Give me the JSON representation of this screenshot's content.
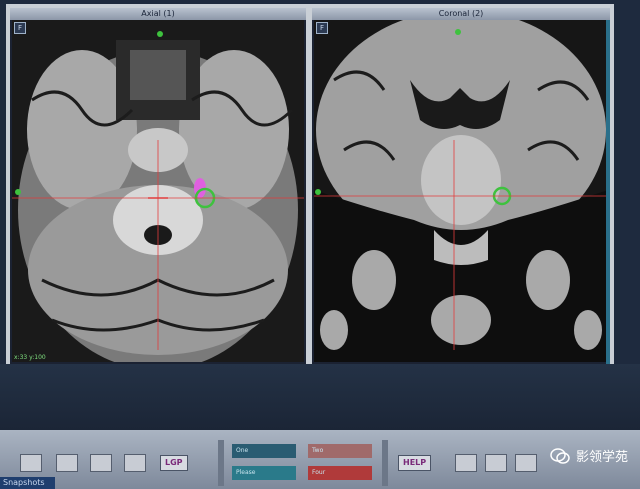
{
  "viewer": {
    "axial": {
      "title": "Axial (1)",
      "corner": "F",
      "coord": "x:33  y:100"
    },
    "coronal": {
      "title": "Coronal (2)",
      "corner": "F"
    }
  },
  "toolbar": {
    "brand_left": "LGP",
    "brand_right": "HELP",
    "fields": [
      "One",
      "Two",
      "Please",
      "Four"
    ],
    "snapshot": "Snapshots"
  },
  "watermark": {
    "text": "影领学苑"
  }
}
